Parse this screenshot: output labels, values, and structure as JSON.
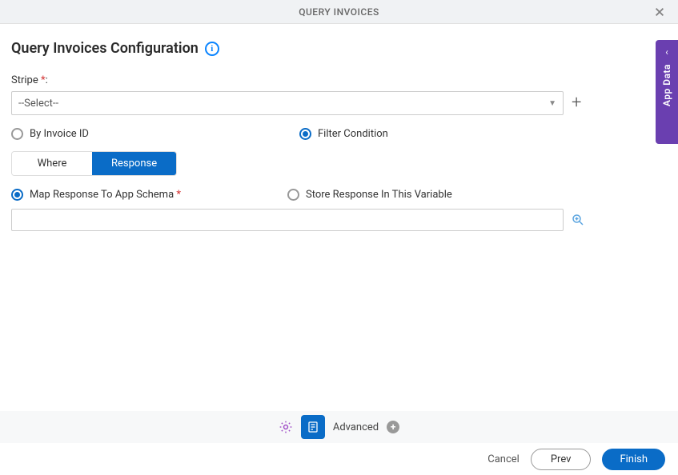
{
  "header": {
    "title": "QUERY INVOICES"
  },
  "page": {
    "title": "Query Invoices Configuration"
  },
  "stripe": {
    "label": "Stripe",
    "placeholder": "--Select--"
  },
  "query_mode": {
    "by_invoice_id": "By Invoice ID",
    "filter_condition": "Filter Condition"
  },
  "tabs": {
    "where": "Where",
    "response": "Response"
  },
  "response_mode": {
    "map_to_schema": "Map Response To App Schema",
    "store_in_variable": "Store Response In This Variable"
  },
  "toolbar": {
    "advanced": "Advanced"
  },
  "footer": {
    "cancel": "Cancel",
    "prev": "Prev",
    "finish": "Finish"
  },
  "side_panel": {
    "label": "App Data"
  }
}
